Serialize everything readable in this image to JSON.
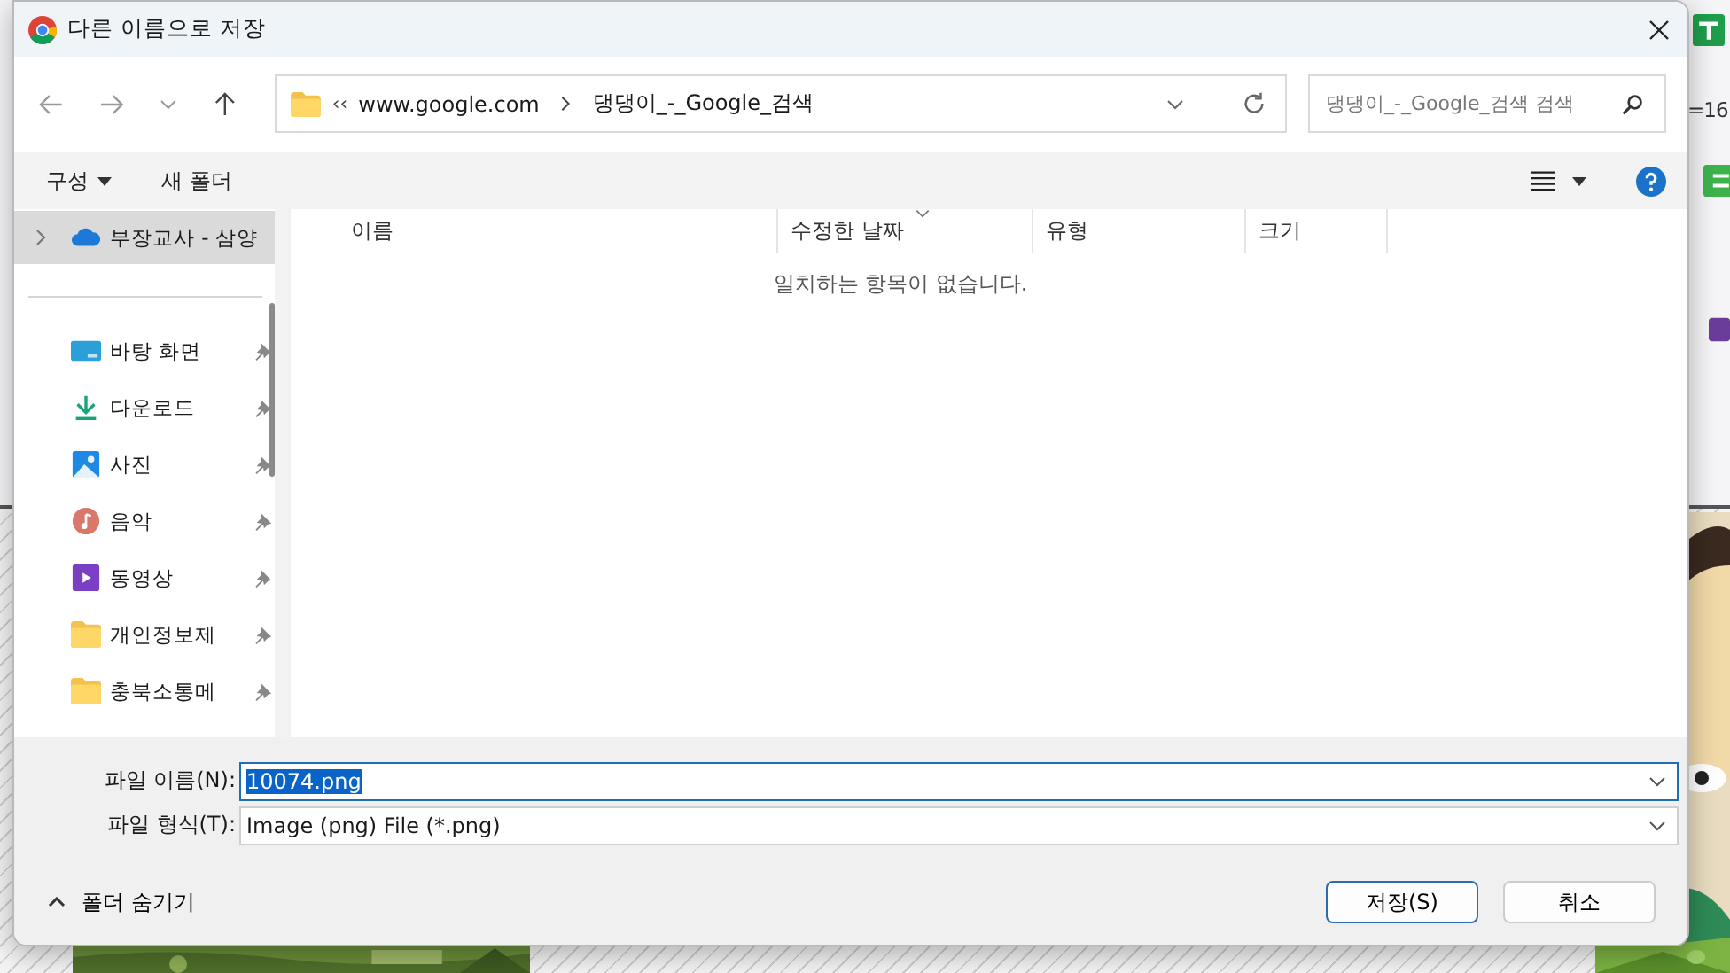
{
  "background": {
    "zoom_text": "=16"
  },
  "window": {
    "title": "다른 이름으로 저장"
  },
  "address_bar": {
    "overflow": "‹‹",
    "path": [
      "www.google.com",
      "댕댕이_-_Google_검색"
    ]
  },
  "search": {
    "placeholder": "댕댕이_-_Google_검색 검색"
  },
  "toolbar": {
    "organize": "구성",
    "new_folder": "새 폴더"
  },
  "sidebar": {
    "items": [
      {
        "label": "부장교사 - 삼양",
        "kind": "cloud",
        "pinned": false,
        "selected": true
      },
      {
        "label": "바탕 화면",
        "kind": "desktop",
        "pinned": true,
        "selected": false
      },
      {
        "label": "다운로드",
        "kind": "download",
        "pinned": true,
        "selected": false
      },
      {
        "label": "사진",
        "kind": "pictures",
        "pinned": true,
        "selected": false
      },
      {
        "label": "음악",
        "kind": "music",
        "pinned": true,
        "selected": false
      },
      {
        "label": "동영상",
        "kind": "videos",
        "pinned": true,
        "selected": false
      },
      {
        "label": "개인정보제",
        "kind": "folder",
        "pinned": true,
        "selected": false
      },
      {
        "label": "충북소통메",
        "kind": "folder",
        "pinned": true,
        "selected": false
      }
    ]
  },
  "columns": [
    {
      "label": "이름",
      "sorted": false
    },
    {
      "label": "수정한 날짜",
      "sorted": true
    },
    {
      "label": "유형",
      "sorted": false
    },
    {
      "label": "크기",
      "sorted": false
    }
  ],
  "empty_message": "일치하는 항목이 없습니다.",
  "file_name": {
    "label": "파일 이름(N):",
    "value": "10074.png",
    "selected": true
  },
  "file_type": {
    "label": "파일 형식(T):",
    "value": "Image (png) File (*.png)"
  },
  "hide_folders": "폴더 숨기기",
  "buttons": [
    {
      "label": "저장(S)",
      "default": true
    },
    {
      "label": "취소",
      "default": false
    }
  ]
}
